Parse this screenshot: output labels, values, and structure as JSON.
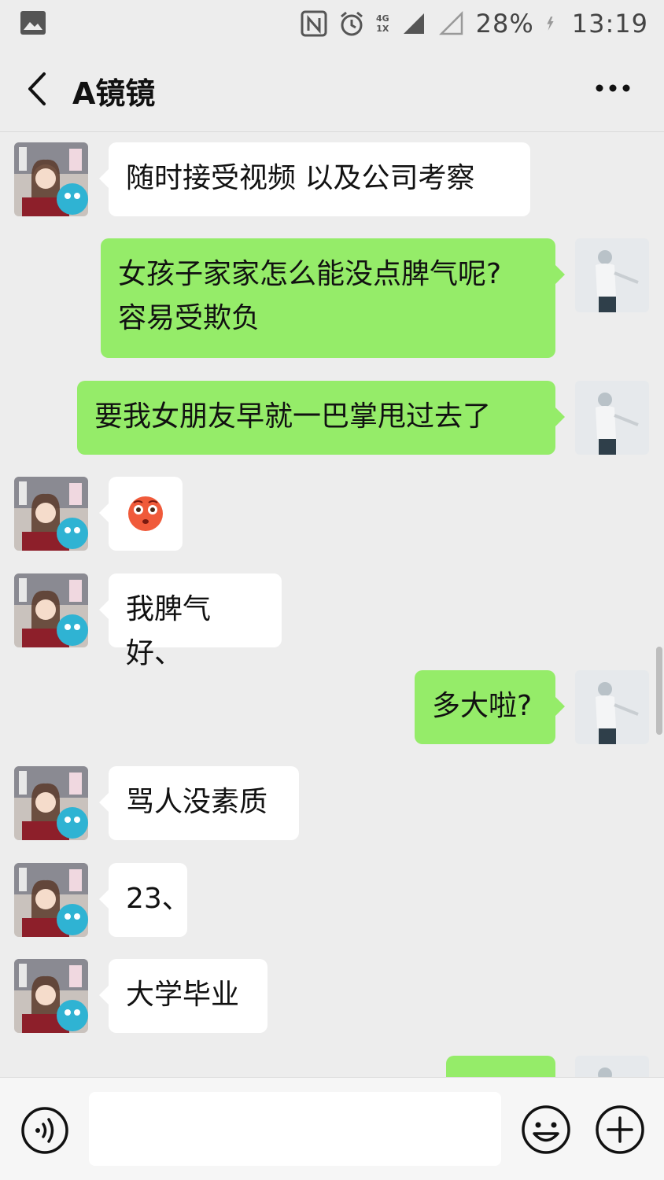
{
  "status_bar": {
    "network": "4G",
    "network_secondary": "1X",
    "battery": "28%",
    "time": "13:19"
  },
  "header": {
    "title": "A镜镜"
  },
  "messages": [
    {
      "side": "left",
      "text": "随时接受视频 以及公司考察"
    },
    {
      "side": "right",
      "lines": [
        "女孩子家家怎么能没点脾气呢?",
        "容易受欺负"
      ]
    },
    {
      "side": "right",
      "text": "要我女朋友早就一巴掌甩过去了"
    },
    {
      "side": "left",
      "emoji": "flushed-face"
    },
    {
      "side": "left",
      "text": "我脾气好、"
    },
    {
      "side": "right",
      "text": "多大啦?"
    },
    {
      "side": "left",
      "text": "骂人没素质"
    },
    {
      "side": "left",
      "text": "23、"
    },
    {
      "side": "left",
      "text": "大学毕业"
    },
    {
      "side": "right",
      "text": ""
    }
  ],
  "colors": {
    "background": "#ededed",
    "outgoing_bubble": "#95ec69",
    "incoming_bubble": "#ffffff"
  },
  "icons": {
    "voice": "voice-icon",
    "emoji": "emoji-icon",
    "more": "plus-icon"
  }
}
